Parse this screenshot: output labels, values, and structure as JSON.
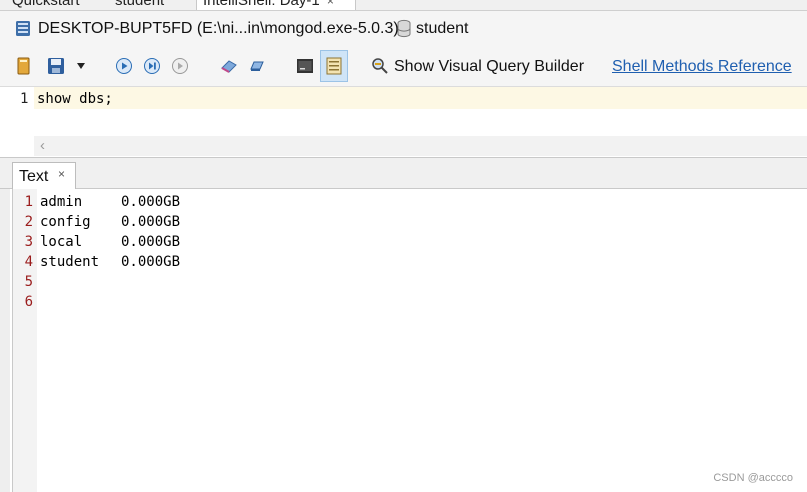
{
  "tabs": [
    {
      "label": "Quickstart",
      "active": false
    },
    {
      "label": "student",
      "active": false
    },
    {
      "label": "IntelliShell: Day-1",
      "active": true
    }
  ],
  "tab_close_glyph": "×",
  "connection": {
    "host": "DESKTOP-BUPT5FD (E:\\ni...in\\mongod.exe-5.0.3)",
    "database": "student"
  },
  "toolbar": {
    "query_builder_label": "Show Visual Query Builder",
    "shell_reference_link": "Shell Methods Reference"
  },
  "editor": {
    "lines": [
      {
        "number": "1",
        "code": "show dbs;"
      }
    ],
    "scroll_left_glyph": "‹"
  },
  "results": {
    "tab_label": "Text",
    "rows": [
      {
        "number": "1",
        "name": "admin",
        "size": "0.000GB"
      },
      {
        "number": "2",
        "name": "config",
        "size": "0.000GB"
      },
      {
        "number": "3",
        "name": "local",
        "size": "0.000GB"
      },
      {
        "number": "4",
        "name": "student",
        "size": "0.000GB"
      },
      {
        "number": "5",
        "name": "",
        "size": ""
      },
      {
        "number": "6",
        "name": "",
        "size": ""
      }
    ]
  },
  "watermark": "CSDN @acccco",
  "colors": {
    "accent_link": "#1f5fb0",
    "line_number_red": "#9a1c1c",
    "current_line_highlight": "#fdf8e4"
  }
}
